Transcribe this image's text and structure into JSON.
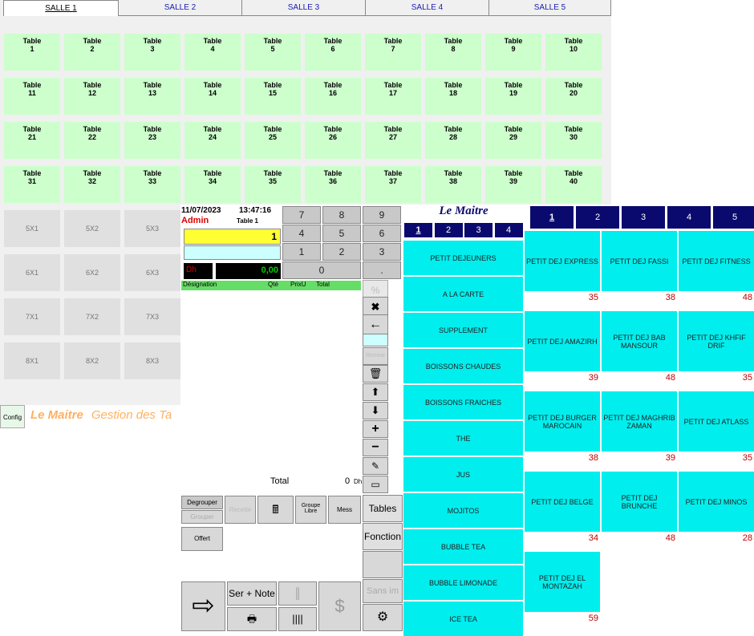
{
  "salles": [
    "SALLE 1",
    "SALLE 2",
    "SALLE 3",
    "SALLE 4",
    "SALLE 5"
  ],
  "table_word": "Table",
  "tables": [
    "1",
    "2",
    "3",
    "4",
    "5",
    "6",
    "7",
    "8",
    "9",
    "10",
    "11",
    "12",
    "13",
    "14",
    "15",
    "16",
    "17",
    "18",
    "19",
    "20",
    "21",
    "22",
    "23",
    "24",
    "25",
    "26",
    "27",
    "28",
    "29",
    "30",
    "31",
    "32",
    "33",
    "34",
    "35",
    "36",
    "37",
    "38",
    "39",
    "40"
  ],
  "grid_tables": [
    [
      "5X1",
      "5X2",
      "5X3"
    ],
    [
      "6X1",
      "6X2",
      "6X3"
    ],
    [
      "7X1",
      "7X2",
      "7X3"
    ],
    [
      "8X1",
      "8X2",
      "8X3"
    ]
  ],
  "footer": {
    "config": "Config",
    "brand": "Le Maitre",
    "brand_sub": "Gestion des Ta"
  },
  "pos": {
    "date": "11/07/2023",
    "time": "13:47:16",
    "user": "Admin",
    "table": "Table 1",
    "qty_display": "1",
    "currency": "Dh",
    "amount": "0,00",
    "count": "0",
    "headers": {
      "designation": "Désignation",
      "qty": "Qté",
      "prix": "PrixU",
      "total": "Total"
    },
    "total_label": "Total",
    "total_value": "0",
    "total_unit": "Dh",
    "keypad": [
      "7",
      "8",
      "9",
      "4",
      "5",
      "6",
      "1",
      "2",
      "3",
      "."
    ],
    "bottom": {
      "degrouper": "Degrouper",
      "grouper": "Grouper",
      "recette": "Recette",
      "groupe_libre": "Groupe Libre",
      "mess": "Mess",
      "offert": "Offert",
      "ser_note": "Ser + Note",
      "tables": "Tables",
      "fonction": "Fonction",
      "sans_im": "Sans im",
      "remise": "Remise",
      "percent": "%"
    },
    "brand": "Le Maitre",
    "category_pages": [
      "1",
      "2",
      "3",
      "4"
    ],
    "categories": [
      "PETIT DEJEUNERS",
      "A LA CARTE",
      "SUPPLEMENT",
      "BOISSONS CHAUDES",
      "BOISSONS FRAICHES",
      "THE",
      "JUS",
      "MOJITOS",
      "BUBBLE TEA",
      "BUBBLE LIMONADE",
      "ICE TEA"
    ],
    "product_pages": [
      "1",
      "2",
      "3",
      "4",
      "5"
    ],
    "products": [
      {
        "name": "PETIT DEJ EXPRESS",
        "price": "35"
      },
      {
        "name": "PETIT DEJ FASSI",
        "price": "38"
      },
      {
        "name": "PETIT DEJ FITNESS",
        "price": "48"
      },
      {
        "name": "PETIT DEJ AMAZIRH",
        "price": "39"
      },
      {
        "name": "PETIT DEJ BAB MANSOUR",
        "price": "48"
      },
      {
        "name": "PETIT DEJ KHFIF DRIF",
        "price": "35"
      },
      {
        "name": "PETIT DEJ BURGER MAROCAIN",
        "price": "38"
      },
      {
        "name": "PETIT DEJ MAGHRIB ZAMAN",
        "price": "39"
      },
      {
        "name": "PETIT DEJ ATLASS",
        "price": "35"
      },
      {
        "name": "PETIT DEJ BELGE",
        "price": "34"
      },
      {
        "name": "PETIT DEJ BRUNCHE",
        "price": "48"
      },
      {
        "name": "PETIT DEJ MINOS",
        "price": "28"
      },
      {
        "name": "PETIT DEJ EL MONTAZAH",
        "price": "59"
      }
    ]
  }
}
